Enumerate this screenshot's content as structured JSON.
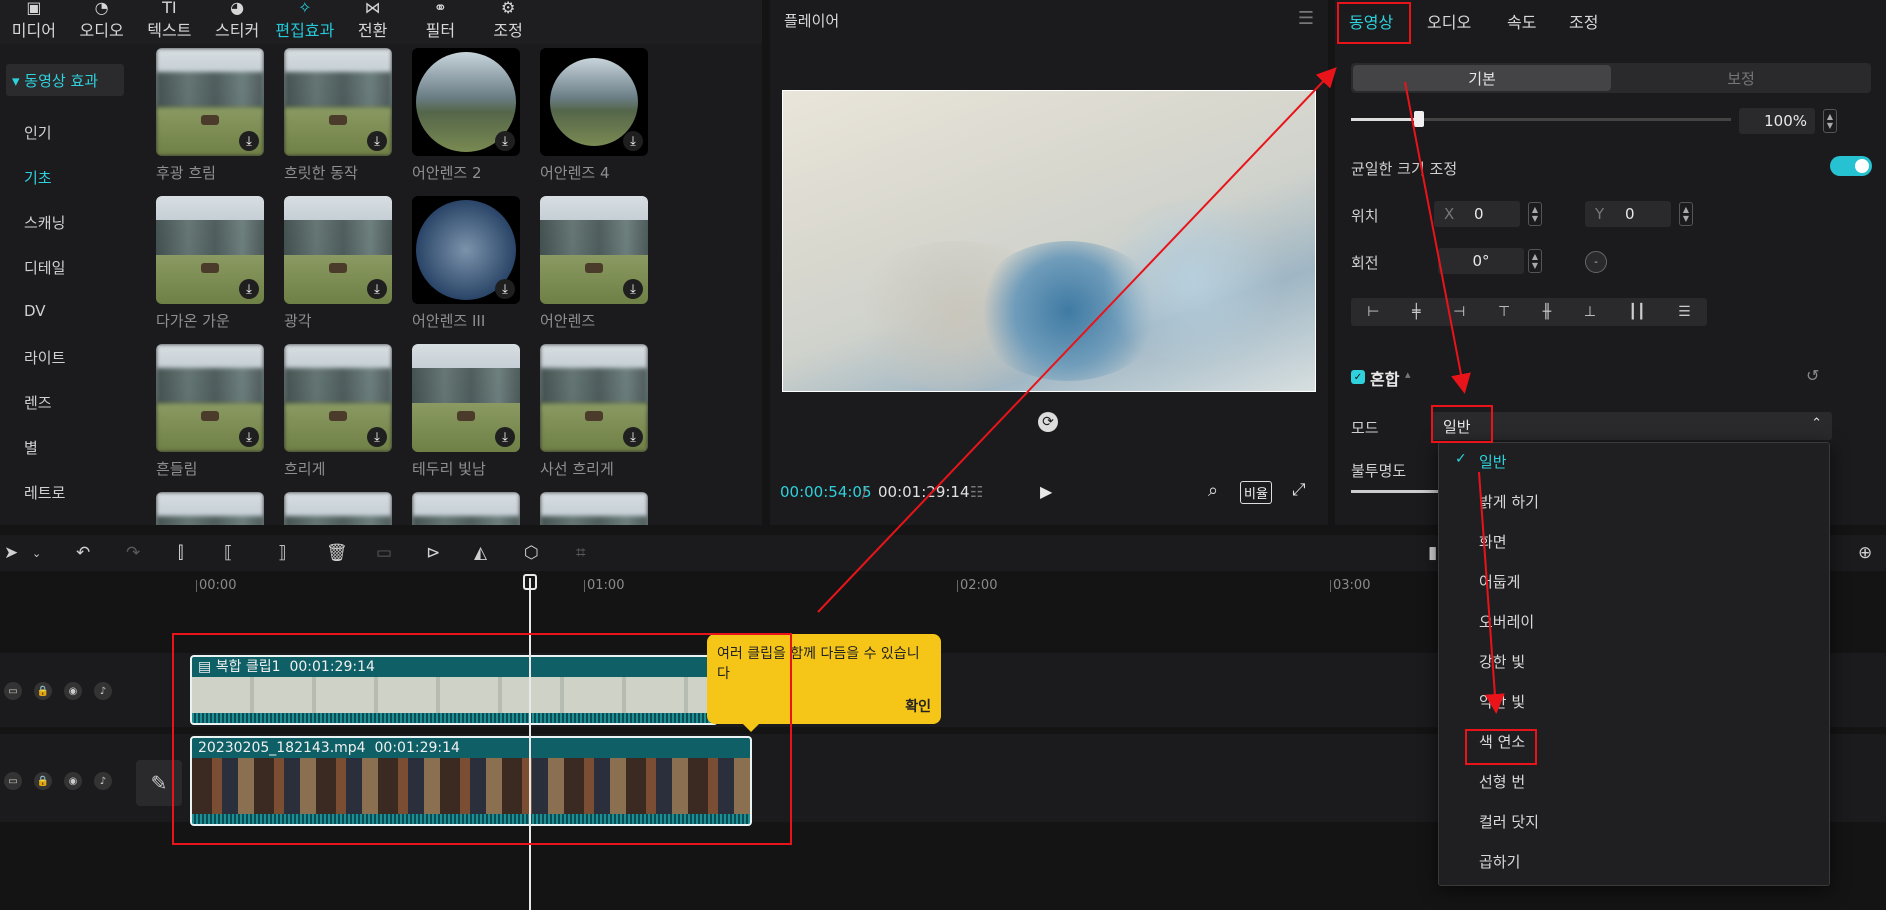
{
  "toolbar": {
    "items": [
      {
        "label": "미디어",
        "icon": "media-icon"
      },
      {
        "label": "오디오",
        "icon": "audio-icon"
      },
      {
        "label": "텍스트",
        "icon": "text-icon"
      },
      {
        "label": "스티커",
        "icon": "sticker-icon"
      },
      {
        "label": "편집효과",
        "icon": "effects-icon"
      },
      {
        "label": "전환",
        "icon": "transition-icon"
      },
      {
        "label": "필터",
        "icon": "filter-icon"
      },
      {
        "label": "조정",
        "icon": "adjust-icon"
      }
    ],
    "active_index": 4
  },
  "sidebar": {
    "header": "▾ 동영상 효과",
    "categories": [
      "인기",
      "기초",
      "스캐닝",
      "디테일",
      "DV",
      "라이트",
      "렌즈",
      "별",
      "레트로"
    ],
    "active_category": "기초"
  },
  "effects": {
    "items": [
      "후광 흐림",
      "흐릿한 동작",
      "어안렌즈 2",
      "어안렌즈 4",
      "다가온 가운",
      "광각",
      "어안렌즈 III",
      "어안렌즈",
      "흔들림",
      "흐리게",
      "테두리 빛남",
      "사선 흐리게"
    ]
  },
  "player": {
    "title": "플레이어",
    "time_current": "00:00:54:05",
    "time_separator": "/",
    "time_total": "00:01:29:14",
    "ratio_label": "비율"
  },
  "properties": {
    "tabs": [
      "동영상",
      "오디오",
      "속도",
      "조정"
    ],
    "active_tab": "동영상",
    "segments": {
      "basic": "기본",
      "adjust": "보정"
    },
    "scale": {
      "value": "100%",
      "level": 0.18
    },
    "uniform_scale_label": "균일한 크기 조정",
    "uniform_scale_on": true,
    "position": {
      "label": "위치",
      "x_axis": "X",
      "x": "0",
      "y_axis": "Y",
      "y": "0"
    },
    "rotation": {
      "label": "회전",
      "value": "0°"
    },
    "blend": {
      "label": "혼합",
      "mode_label": "모드",
      "mode_value": "일반",
      "opacity_label": "불투명도"
    }
  },
  "blend_modes": {
    "options": [
      "일반",
      "밝게 하기",
      "화면",
      "어둡게",
      "오버레이",
      "강한 빛",
      "약한 빛",
      "색 연소",
      "선형 번",
      "컬러 닷지",
      "곱하기"
    ],
    "selected": "일반",
    "highlighted": "색 연소"
  },
  "timeline": {
    "ticks": [
      "00:00",
      "01:00",
      "02:00",
      "03:00"
    ],
    "compound_clip": {
      "name": "복합 클립1",
      "duration": "00:01:29:14"
    },
    "video_clip": {
      "name": "20230205_182143.mp4",
      "duration": "00:01:29:14"
    }
  },
  "tooltip": {
    "text": "여러 클립을 함께 다듬을 수 있습니다",
    "confirm": "확인"
  },
  "colors": {
    "accent": "#2ed1dc",
    "annotation": "#e8141a",
    "tooltip": "#f5c518"
  }
}
